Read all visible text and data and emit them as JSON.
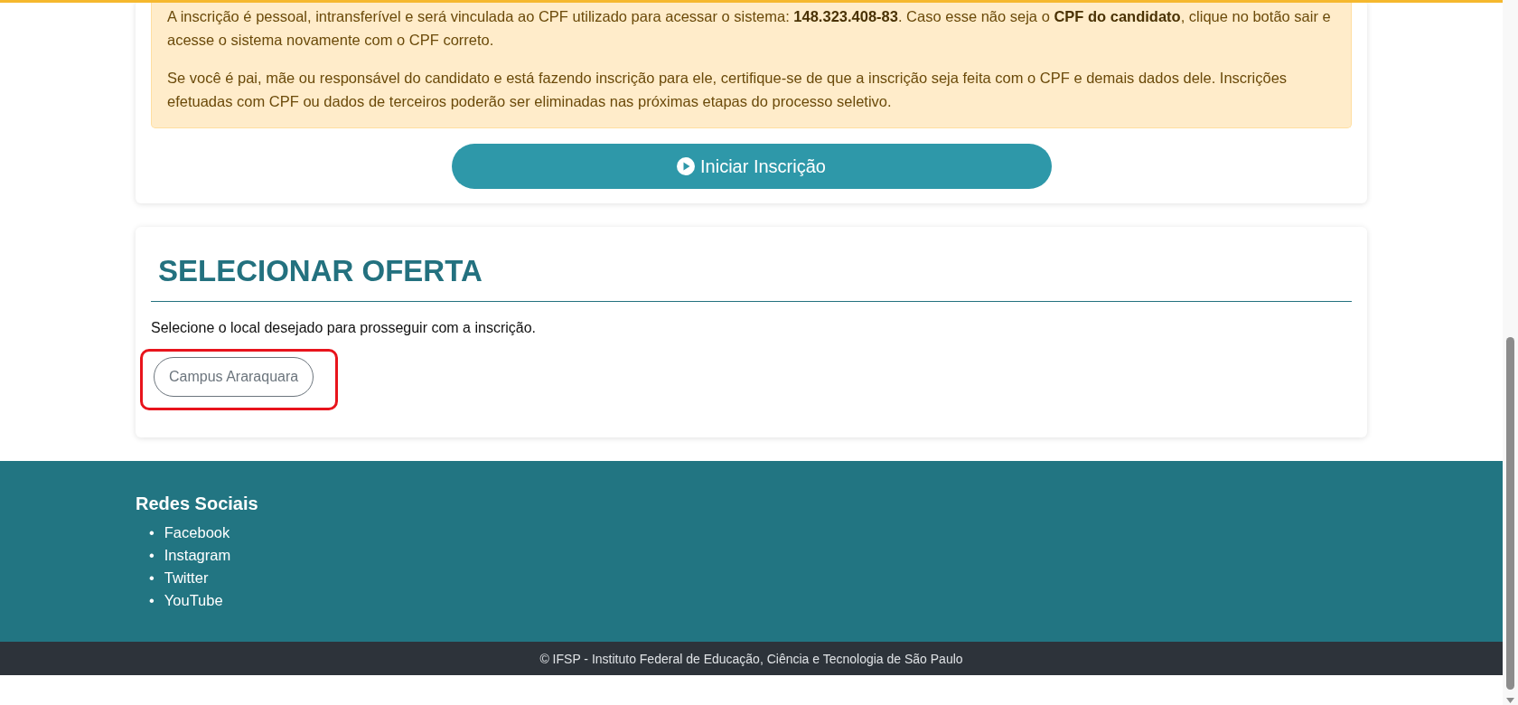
{
  "notice": {
    "paragraphs": [
      "A inscrição é pessoal, intransferível e será vinculada ao CPF utilizado para acessar o sistema: **148.323.408-83**. Caso esse não seja o **CPF do candidato**, clique no botão sair e acesse o sistema novamente com o CPF correto.",
      "Se você é pai, mãe ou responsável do candidato e está fazendo inscrição para ele, certifique-se de que a inscrição seja feita com o CPF e demais dados dele. Inscrições efetuadas com CPF ou dados de terceiros poderão ser eliminadas nas próximas etapas do processo seletivo."
    ]
  },
  "start_button": {
    "label": "Iniciar Inscrição"
  },
  "offer_section": {
    "title": "SELECIONAR OFERTA",
    "instruction": "Selecione o local desejado para prosseguir com a inscrição.",
    "options": [
      {
        "label": "Campus Araraquara",
        "highlighted": true
      }
    ]
  },
  "footer": {
    "title": "Redes Sociais",
    "links": [
      {
        "bullet": "•",
        "label": "Facebook"
      },
      {
        "bullet": "•",
        "label": "Instagram"
      },
      {
        "bullet": "•",
        "label": "Twitter"
      },
      {
        "bullet": "•",
        "label": "YouTube"
      }
    ],
    "copyright": "© IFSP - Instituto Federal de Educação, Ciência e Tecnologia de São Paulo"
  }
}
